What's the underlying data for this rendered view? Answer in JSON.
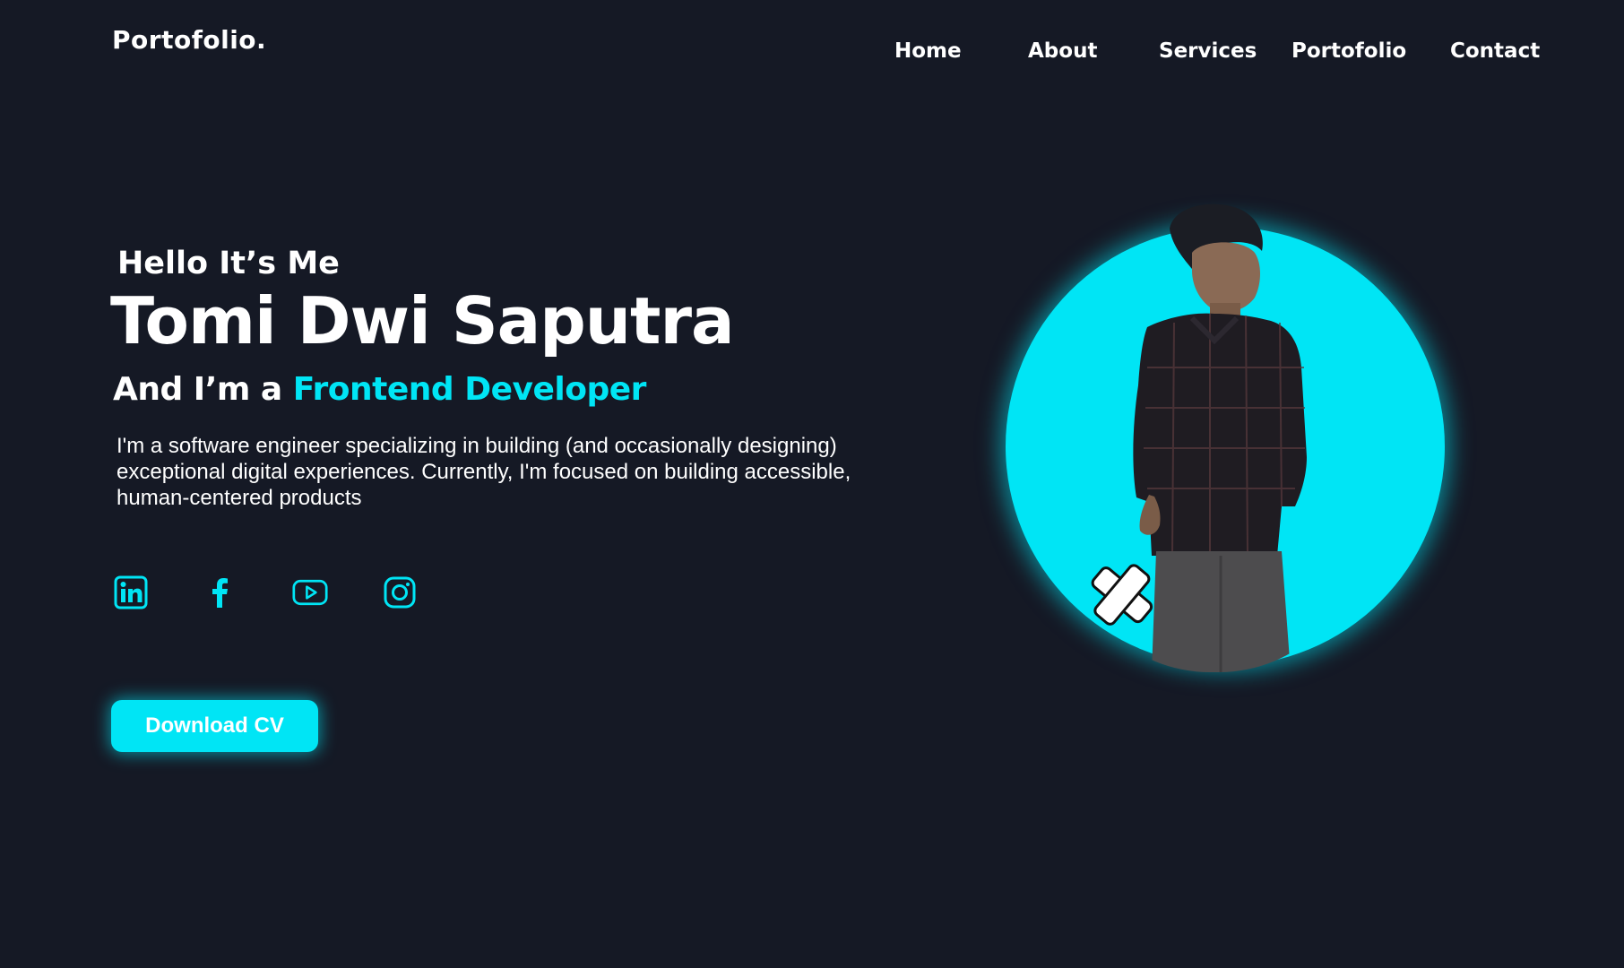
{
  "header": {
    "logo": "Portofolio.",
    "nav": [
      {
        "label": "Home"
      },
      {
        "label": "About"
      },
      {
        "label": "Services"
      },
      {
        "label": "Portofolio"
      },
      {
        "label": "Contact"
      }
    ]
  },
  "hero": {
    "greeting": "Hello  It’s Me",
    "name": "Tomi Dwi Saputra",
    "role_prefix": "And I’m a ",
    "role_highlight": "Frontend Developer",
    "description": "I'm a software engineer specializing in building (and occasionally designing) exceptional digital experiences. Currently, I'm focused on building accessible, human-centered products",
    "download_label": "Download CV"
  },
  "social": [
    {
      "icon": "linkedin-icon"
    },
    {
      "icon": "facebook-icon"
    },
    {
      "icon": "youtube-icon"
    },
    {
      "icon": "instagram-icon"
    }
  ],
  "colors": {
    "background": "#151925",
    "accent": "#00e5f5",
    "text": "#ffffff"
  }
}
